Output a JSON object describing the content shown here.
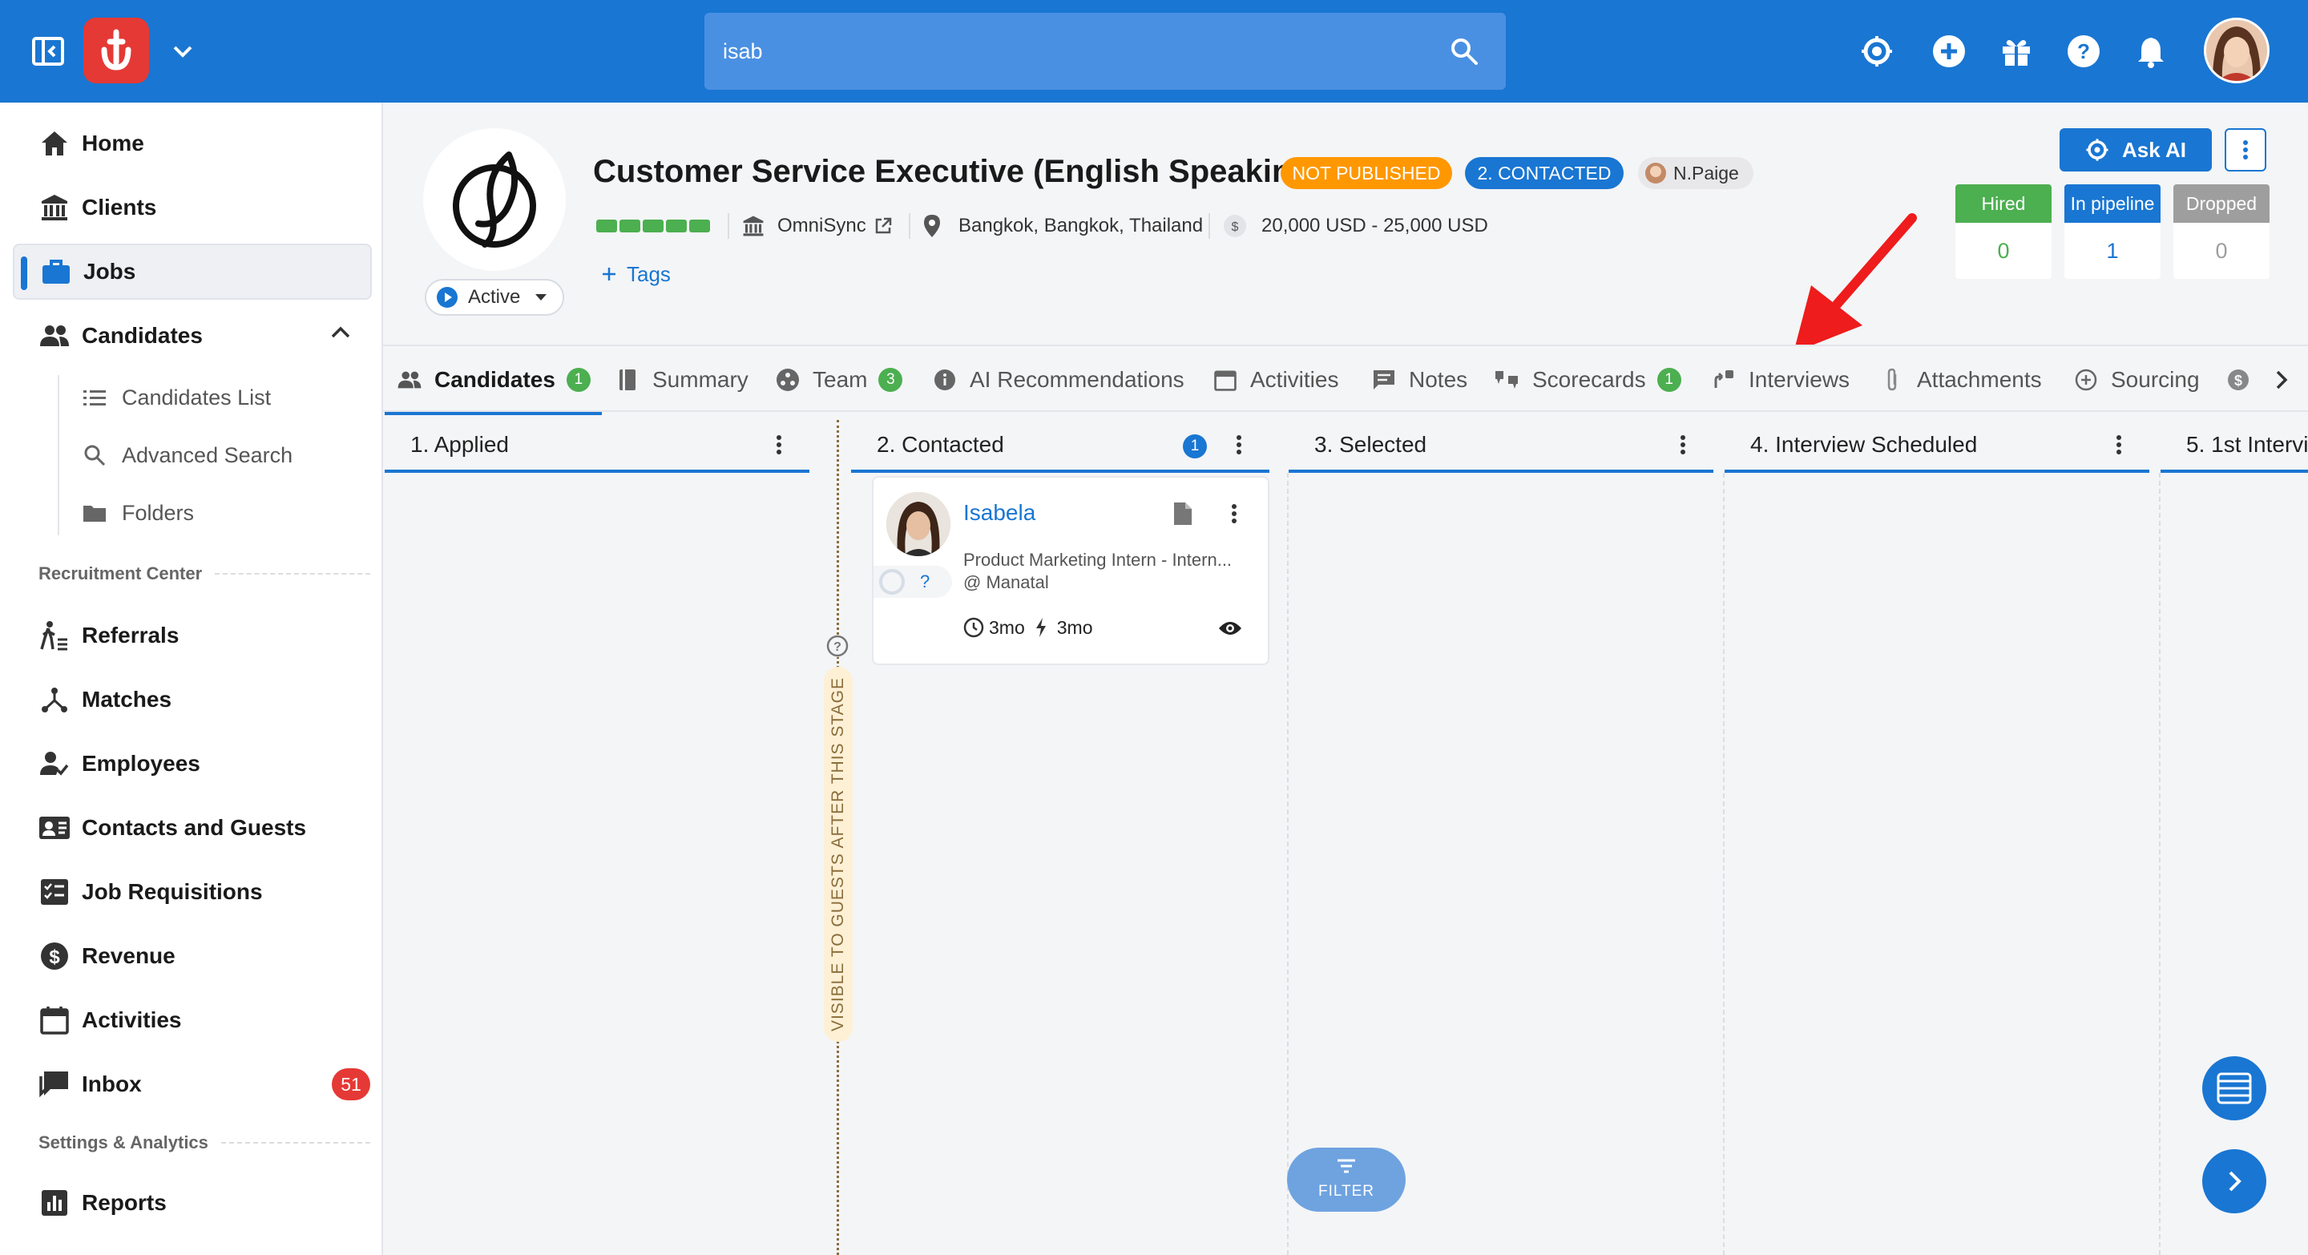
{
  "colors": {
    "primary": "#1976d2",
    "brand_red": "#e53935",
    "orange": "#ff9800",
    "green": "#4caf50",
    "grey": "#9e9e9e"
  },
  "topbar": {
    "search_value": "isab",
    "icons": [
      "sidebar-toggle-icon",
      "manatal-logo-icon",
      "chevron-down-icon",
      "search-icon",
      "ai-icon",
      "add-icon",
      "gift-icon",
      "help-icon",
      "bell-icon"
    ]
  },
  "sidebar": {
    "items": [
      {
        "label": "Home",
        "icon": "home-icon"
      },
      {
        "label": "Clients",
        "icon": "building-icon"
      },
      {
        "label": "Jobs",
        "icon": "briefcase-icon"
      },
      {
        "label": "Candidates",
        "icon": "people-icon"
      }
    ],
    "candidates_sub": [
      {
        "label": "Candidates List",
        "icon": "list-icon"
      },
      {
        "label": "Advanced Search",
        "icon": "search-icon"
      },
      {
        "label": "Folders",
        "icon": "folder-icon"
      }
    ],
    "section_recruitment": "Recruitment Center",
    "recruitment_items": [
      {
        "label": "Referrals",
        "icon": "referral-icon"
      },
      {
        "label": "Matches",
        "icon": "matches-icon"
      },
      {
        "label": "Employees",
        "icon": "employee-icon"
      },
      {
        "label": "Contacts and Guests",
        "icon": "contacts-icon"
      },
      {
        "label": "Job Requisitions",
        "icon": "requisition-icon"
      },
      {
        "label": "Revenue",
        "icon": "dollar-icon"
      },
      {
        "label": "Activities",
        "icon": "calendar-icon"
      },
      {
        "label": "Inbox",
        "icon": "inbox-icon",
        "badge": "51"
      }
    ],
    "section_settings": "Settings & Analytics",
    "settings_items": [
      {
        "label": "Reports",
        "icon": "reports-icon"
      }
    ]
  },
  "job": {
    "title": "Customer Service Executive (English Speaking)",
    "publish_status": "NOT PUBLISHED",
    "stage_status": "2. CONTACTED",
    "owner": "N.Paige",
    "client": "OmniSync",
    "location": "Bangkok, Bangkok, Thailand",
    "salary": "20,000 USD - 25,000 USD",
    "status": "Active",
    "tags_label": "Tags"
  },
  "actions": {
    "ask_ai": "Ask AI"
  },
  "stats": [
    {
      "label": "Hired",
      "value": "0",
      "color": "#4caf50"
    },
    {
      "label": "In pipeline",
      "value": "1",
      "color": "#1976d2"
    },
    {
      "label": "Dropped",
      "value": "0",
      "color": "#9e9e9e"
    }
  ],
  "tabs": [
    {
      "label": "Candidates",
      "count": "1",
      "icon": "people-icon"
    },
    {
      "label": "Summary",
      "icon": "book-icon"
    },
    {
      "label": "Team",
      "count": "3",
      "icon": "team-icon"
    },
    {
      "label": "AI Recommendations",
      "icon": "info-icon"
    },
    {
      "label": "Activities",
      "icon": "calendar-icon"
    },
    {
      "label": "Notes",
      "icon": "note-icon"
    },
    {
      "label": "Scorecards",
      "count": "1",
      "icon": "scorecard-icon"
    },
    {
      "label": "Interviews",
      "icon": "interview-icon"
    },
    {
      "label": "Attachments",
      "icon": "paperclip-icon"
    },
    {
      "label": "Sourcing",
      "icon": "sourcing-icon"
    }
  ],
  "columns": [
    {
      "label": "1. Applied"
    },
    {
      "label": "2. Contacted",
      "count": "1"
    },
    {
      "label": "3. Selected"
    },
    {
      "label": "4. Interview Scheduled"
    },
    {
      "label": "5. 1st Intervi"
    }
  ],
  "card": {
    "name": "Isabela",
    "role": "Product Marketing Intern - Intern...",
    "company": "@ Manatal",
    "rating": "?",
    "time_in_stage": "3mo",
    "last_activity": "3mo"
  },
  "guest_notice": "VISIBLE TO GUESTS AFTER THIS STAGE",
  "filter_label": "FILTER"
}
